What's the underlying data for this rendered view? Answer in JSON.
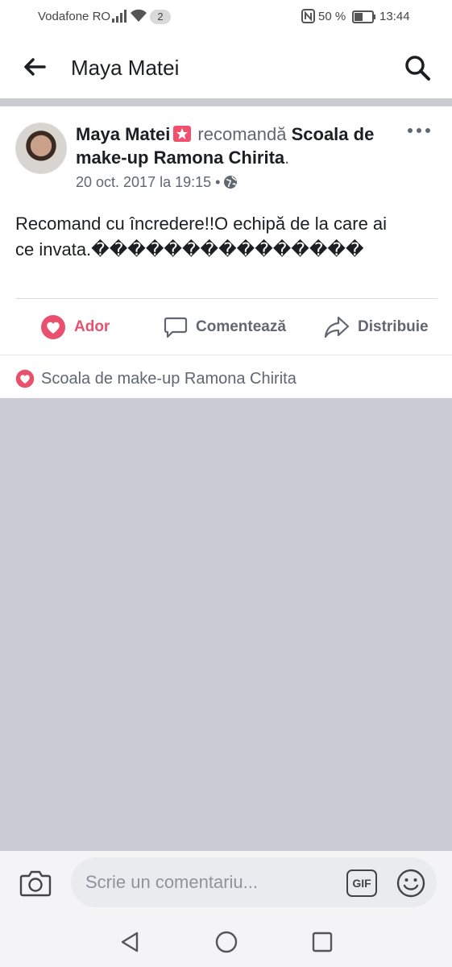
{
  "status_bar": {
    "carrier": "Vodafone RO",
    "notification_count": "2",
    "battery_percent": "50 %",
    "time": "13:44",
    "icons": [
      "signal-icon",
      "wifi-icon",
      "nfc-icon",
      "battery-icon"
    ]
  },
  "nav": {
    "title": "Maya Matei",
    "icons": [
      "back-arrow-icon",
      "search-icon"
    ]
  },
  "post": {
    "author": "Maya Matei",
    "verb": "recomandă",
    "page_name": "Scoala de make-up Ramona Chirita",
    "trailing_punct": ".",
    "timestamp": "20 oct. 2017 la 19:15",
    "separator": "•",
    "privacy_icon": "globe-icon",
    "text_line1": "Recomand cu încredere!!O echipă  de la care ai",
    "text_line2": "ce invata.���������������",
    "actions": {
      "love": "Ador",
      "comment": "Comentează",
      "share": "Distribuie"
    },
    "reaction_summary": "Scoala de make-up Ramona Chirita"
  },
  "composer": {
    "placeholder": "Scrie un comentariu...",
    "gif_label": "GIF"
  },
  "colors": {
    "love": "#e9506e",
    "divider": "#c9ccd1",
    "gray_area": "#cacbd3",
    "text_secondary": "#606770"
  }
}
